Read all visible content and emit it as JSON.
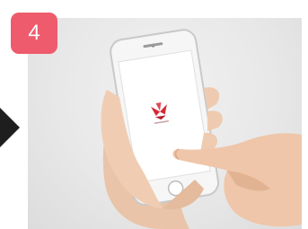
{
  "step": {
    "number": "4",
    "badge_color": "#ee5b6d"
  },
  "arrow": {
    "icon": "triangle-right-icon",
    "color": "#1e1e1e"
  },
  "phone": {
    "model": "smartphone",
    "screen_logo_icon": "red-flower-logo-icon",
    "logo_color": "#d6283a"
  }
}
